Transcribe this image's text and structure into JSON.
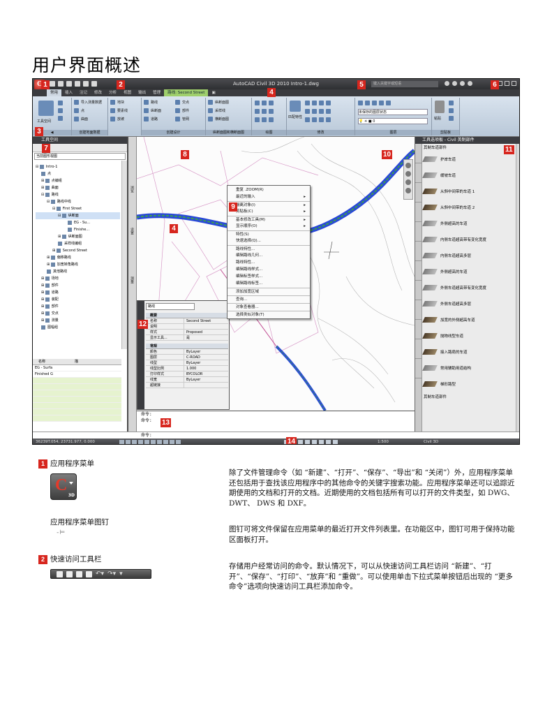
{
  "page": {
    "title": "用户界面概述"
  },
  "screenshot": {
    "window_title": "AutoCAD Civil 3D 2010  Intro-1.dwg",
    "search_placeholder": "键入关键字或短语",
    "tabs": [
      "常用",
      "插入",
      "注记",
      "修改",
      "分析",
      "视图",
      "输出",
      "管理",
      "路线: Second Street",
      "▣"
    ],
    "ribbon_panels": [
      {
        "label": "工具空间",
        "items": [
          "导入测量数据",
          "点",
          "曲面"
        ]
      },
      {
        "label": "创建地面数据",
        "items": [
          "地块",
          "要素线",
          "放坡"
        ]
      },
      {
        "label": "创建设计",
        "items": [
          "路线",
          "纵断面",
          "道路",
          "交点",
          "部件",
          "管网"
        ]
      },
      {
        "label": "纵断面图和横断面图",
        "items": [
          "纵断面图",
          "采样线",
          "横断面图"
        ]
      },
      {
        "label": "绘图",
        "items": []
      },
      {
        "label": "修改",
        "items": [
          "匹配特性"
        ]
      },
      {
        "label": "图层",
        "items": [
          "未保存的图层状态"
        ]
      },
      {
        "label": "剪贴板",
        "items": [
          "粘贴"
        ]
      }
    ],
    "toolspace": {
      "title": "工具空间",
      "view": "当前图形视图",
      "tree": [
        "Intro-1",
        "点",
        "点编组",
        "曲面",
        "路线",
        "路线中线",
        "First Street",
        "纵断面",
        "EG - Su...",
        "Finishe...",
        "纵断面图",
        "采样线编组",
        "Second Street",
        "偏移路线",
        "加宽转角路线",
        "其他路线",
        "场地",
        "部件",
        "道路",
        "装配",
        "部件",
        "交点",
        "测量",
        "图幅组"
      ],
      "table_headers": [
        "名称",
        "描"
      ],
      "table_rows": [
        "EG - Surfa",
        "Finished G"
      ]
    },
    "context_menu": [
      "重复 .ZOOM(R)",
      "最近的输入",
      "隔离对象(I)",
      "剪贴板(C)",
      "基本修改工具(M)",
      "显示顺序(O)",
      "特性(S)",
      "快速选择(Q)...",
      "路线特性...",
      "编辑路线几何...",
      "路线特性...",
      "编辑路线样式...",
      "编辑标签样式...",
      "编辑路线标签...",
      "添加加宽区域",
      "查询...",
      "对象查看器...",
      "选择类似对象(T)"
    ],
    "properties": {
      "type": "路线",
      "section_general": "概要",
      "section_basic": "常规",
      "rows": [
        [
          "名称",
          "Second Street"
        ],
        [
          "说明",
          ""
        ],
        [
          "样式",
          "Proposed"
        ],
        [
          "显示工具...",
          "是"
        ],
        [
          "颜色",
          "ByLayer"
        ],
        [
          "图层",
          "C-ROAD"
        ],
        [
          "线型",
          "ByLayer"
        ],
        [
          "线型比例",
          "1.000"
        ],
        [
          "打印样式",
          "BYCOLOR"
        ],
        [
          "线宽",
          "ByLayer"
        ],
        [
          "超链接",
          ""
        ]
      ]
    },
    "palette": {
      "title": "工具选项板 - Civil 英制部件",
      "group_header": "其制车道部件",
      "items": [
        "护岸车道",
        "缓坡车道",
        "从斜中间带的车道 1",
        "从斜中间带的车道 2",
        "外侧超高的车道",
        "内侧车道超高带有变化宽度",
        "内侧车道超高多层",
        "外侧超高的车道",
        "外侧车道超高带有变化宽度",
        "外侧车道超高多层",
        "加宽的外侧超高车道",
        "抛物线型车道",
        "接入路肩的车道",
        "常用辅助用道结构",
        "梯形路型"
      ],
      "footer": "其制车道部件"
    },
    "command_lines": [
      "命令:",
      "命令:",
      "命令:"
    ],
    "status": {
      "coords": "36239T.054, 23731.977, 0.000",
      "scale": "1:500",
      "workspace": "Civil 3D"
    },
    "callouts": [
      "1",
      "2",
      "3",
      "4",
      "5",
      "6",
      "7",
      "8",
      "9",
      "10",
      "11",
      "12",
      "13",
      "14"
    ]
  },
  "sections": [
    {
      "num": "1",
      "label": "应用程序菜单",
      "badge": "3D",
      "desc": "除了文件管理命令（如 “新建”、“打开”、“保存”、“导出”和 “关闭”）外，应用程序菜单还包括用于查找该应用程序中的其他命令的关键字搜索功能。应用程序菜单还可以追踪近期使用的文档和打开的文档。近期使用的文档包括所有可以打开的文件类型，如 DWG、 DWT、 DWS 和 DXF。"
    },
    {
      "num": "",
      "label": "应用程序菜单图钉",
      "icon_text": "-⊨",
      "desc": "图钉可将文件保留在应用菜单的最近打开文件列表里。在功能区中，图钉可用于保持功能区面板打开。"
    },
    {
      "num": "2",
      "label": "快速访问工具栏",
      "desc": "存储用户经常访问的命令。默认情况下，可以从快速访问工具栏访问 “新建”、“打开”、“保存”、“打印”、“放弃”和 “重做”。可以使用单击下拉式菜单按钮后出现的 “更多命令”选项向快速访问工具栏添加命令。"
    }
  ]
}
